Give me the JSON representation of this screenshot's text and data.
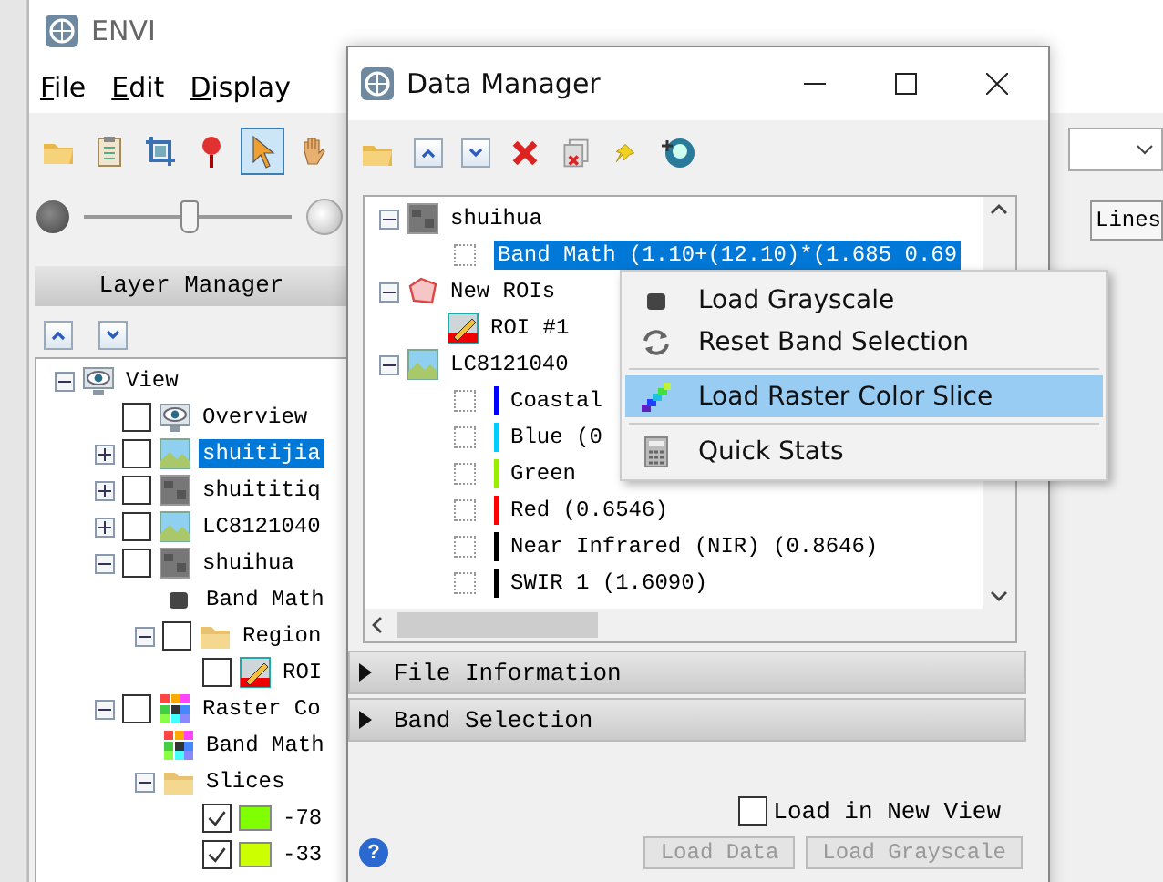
{
  "envi": {
    "title": "ENVI",
    "menu": [
      "File",
      "Edit",
      "Display"
    ],
    "tools": [
      {
        "kind": "open",
        "selected": false
      },
      {
        "kind": "clipboard",
        "selected": false
      },
      {
        "kind": "crop",
        "selected": false
      },
      {
        "kind": "pin",
        "selected": false
      },
      {
        "kind": "cursor",
        "selected": true
      },
      {
        "kind": "hand",
        "selected": false
      }
    ],
    "transparency": {
      "level": 0.5
    },
    "layer_manager": "Layer Manager",
    "layers": [
      {
        "label": "View",
        "kind": "view",
        "expanded": true,
        "selected": false,
        "children": [
          {
            "label": "Overview",
            "kind": "view",
            "checked": false,
            "selected": false
          },
          {
            "label": "shuitijia",
            "kind": "image-color",
            "expanded": false,
            "checked": false,
            "selected": true
          },
          {
            "label": "shuititiq",
            "kind": "image-gray",
            "expanded": false,
            "checked": false,
            "selected": false
          },
          {
            "label": "LC8121040",
            "kind": "image-color",
            "expanded": false,
            "checked": false,
            "selected": false
          },
          {
            "label": "shuihua",
            "kind": "image-gray",
            "expanded": true,
            "checked": false,
            "selected": false,
            "children": [
              {
                "label": "Band Math",
                "kind": "band",
                "selected": false
              },
              {
                "label": "Region",
                "kind": "folder",
                "expanded": true,
                "checked": false,
                "selected": false,
                "children": [
                  {
                    "label": "ROI",
                    "kind": "roi",
                    "checked": false,
                    "selected": false
                  }
                ]
              }
            ]
          },
          {
            "label": "Raster Co",
            "kind": "palette",
            "expanded": true,
            "checked": false,
            "selected": false,
            "children": [
              {
                "label": "Band Math",
                "kind": "palette-small",
                "selected": false
              },
              {
                "label": "Slices",
                "kind": "folder",
                "expanded": true,
                "selected": false,
                "children": [
                  {
                    "label": "-78",
                    "checked": true,
                    "color": "#80ff00",
                    "selected": false
                  },
                  {
                    "label": "-33",
                    "checked": true,
                    "color": "#ccff00",
                    "selected": false
                  }
                ]
              }
            ]
          }
        ]
      }
    ],
    "side_button": "Lines"
  },
  "data_manager": {
    "title": "Data Manager",
    "files": [
      {
        "label": "shuihua",
        "kind": "image-gray",
        "expanded": true,
        "selected": false,
        "children": [
          {
            "label": "Band Math (1.10+(12.10)*(1.685 0.69",
            "kind": "band",
            "checked": false,
            "selected": true
          }
        ]
      },
      {
        "label": "New ROIs",
        "kind": "roi-set",
        "expanded": true,
        "selected": false,
        "children": [
          {
            "label": "ROI #1",
            "kind": "roi",
            "selected": false
          }
        ]
      },
      {
        "label": "LC8121040",
        "kind": "image-color",
        "expanded": true,
        "selected": false,
        "children": [
          {
            "label": "Coastal",
            "kind": "band",
            "checked": false,
            "color": "#0000ff",
            "selected": false
          },
          {
            "label": "Blue (0",
            "kind": "band",
            "checked": false,
            "color": "#00ccff",
            "selected": false
          },
          {
            "label": "Green",
            "kind": "band",
            "checked": false,
            "color": "#99ee00",
            "selected": false
          },
          {
            "label": "Red (0.6546)",
            "kind": "band",
            "checked": false,
            "color": "#ff0000",
            "selected": false
          },
          {
            "label": "Near Infrared (NIR) (0.8646)",
            "kind": "band",
            "checked": false,
            "color": "#000000",
            "selected": false
          },
          {
            "label": "SWIR 1 (1.6090)",
            "kind": "band",
            "checked": false,
            "color": "#000000",
            "selected": false
          }
        ]
      }
    ],
    "context_menu": [
      {
        "label": "Load Grayscale",
        "kind": "grayscale",
        "selected": false
      },
      {
        "label": "Reset Band Selection",
        "kind": "reset",
        "selected": false
      },
      {
        "label": "Load Raster Color Slice",
        "kind": "slice",
        "selected": true
      },
      {
        "label": "Quick Stats",
        "kind": "stats",
        "selected": false
      }
    ],
    "sections": [
      {
        "label": "File Information",
        "expanded": false
      },
      {
        "label": "Band Selection",
        "expanded": false
      }
    ],
    "load_in_new_view": {
      "label": "Load in New View",
      "checked": false
    },
    "help": "?",
    "buttons": [
      {
        "label": "Load Data",
        "disabled": true
      },
      {
        "label": "Load Grayscale",
        "disabled": true
      }
    ]
  }
}
